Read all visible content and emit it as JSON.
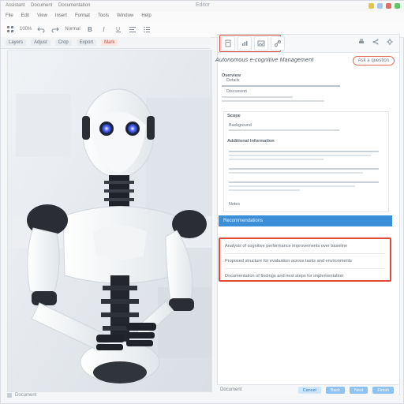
{
  "window": {
    "left_tabs": [
      "Assistant",
      "Document",
      "Documentation"
    ],
    "center_title": "Editor",
    "controls": [
      "minimize",
      "maximize",
      "close",
      "status"
    ]
  },
  "menu": {
    "items": [
      "File",
      "Edit",
      "View",
      "Insert",
      "Format",
      "Tools",
      "Window",
      "Help"
    ]
  },
  "toolbar": {
    "text_left": "100%",
    "text_mid": "Normal",
    "icons": [
      "grid-icon",
      "undo-icon",
      "redo-icon",
      "bold-icon",
      "italic-icon",
      "underline-icon",
      "align-icon",
      "list-icon"
    ]
  },
  "row2": {
    "items": [
      "Layers",
      "Adjust",
      "Crop",
      "Export",
      "Mark"
    ]
  },
  "image_panel": {
    "caption": "Document"
  },
  "right_panel": {
    "toolbar_tabs": [
      "tab-1",
      "tab-2",
      "tab-3",
      "tab-4"
    ],
    "search_pill": "Ask a question",
    "doc_title": "Autonomous e-cognitive Management",
    "sections": [
      {
        "heading": "Overview",
        "lines": [
          "Details",
          "Discussion"
        ]
      },
      {
        "heading": "Scope",
        "lines": [
          "Background"
        ]
      },
      {
        "heading": "Additional Information",
        "lines": [
          "Notes"
        ]
      }
    ],
    "blue_bar": "Recommendations",
    "highlight_rows": [
      "Analysis of cognitive performance improvements over baseline",
      "Proposed structure for evaluation across tasks and environments",
      "Documentation of findings and next steps for implementation"
    ],
    "bottom_left": "Document",
    "buttons": [
      "Cancel",
      "Back",
      "Next",
      "Finish"
    ]
  },
  "colors": {
    "accent_blue": "#3b8ed8",
    "highlight_red": "#e04a37"
  }
}
